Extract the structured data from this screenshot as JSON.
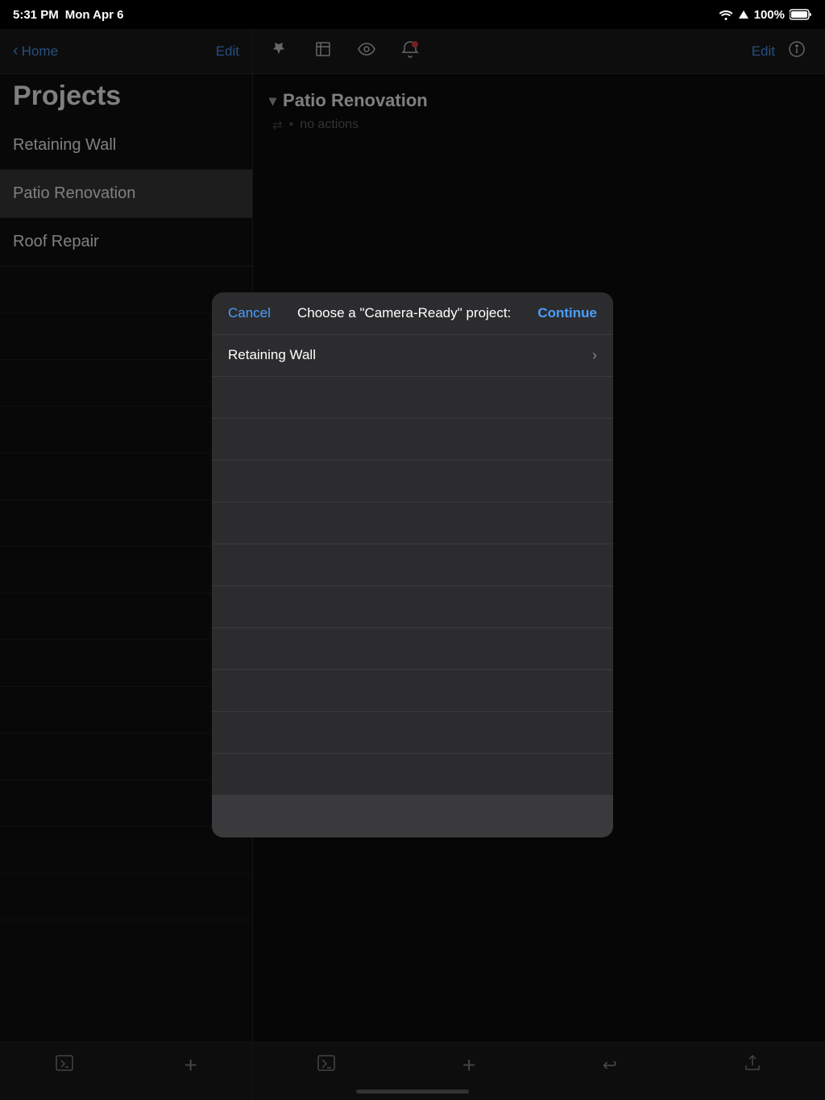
{
  "statusBar": {
    "time": "5:31 PM",
    "date": "Mon Apr 6",
    "battery": "100%",
    "batteryIcon": "🔋"
  },
  "sidebar": {
    "backLabel": "Home",
    "editLabel": "Edit",
    "title": "Projects",
    "projects": [
      {
        "id": 1,
        "name": "Retaining Wall",
        "selected": false
      },
      {
        "id": 2,
        "name": "Patio Renovation",
        "selected": true
      },
      {
        "id": 3,
        "name": "Roof Repair",
        "selected": false
      }
    ]
  },
  "toolbar": {
    "editLabel": "Edit",
    "pinIcon": "📌",
    "fullscreenIcon": "⊡",
    "eyeIcon": "◉",
    "bellIcon": "🔔",
    "infoIcon": "ⓘ"
  },
  "contentPanel": {
    "projectHeading": "Patio Renovation",
    "noActionsLabel": "no actions"
  },
  "bottomBar": {
    "terminalIcon": "terminal",
    "addIcon": "+",
    "undoIcon": "↩",
    "shareIcon": "⬆"
  },
  "modal": {
    "cancelLabel": "Cancel",
    "titleLabel": "Choose a \"Camera-Ready\" project:",
    "continueLabel": "Continue",
    "selectedProject": "Retaining Wall",
    "emptyRows": 10
  }
}
